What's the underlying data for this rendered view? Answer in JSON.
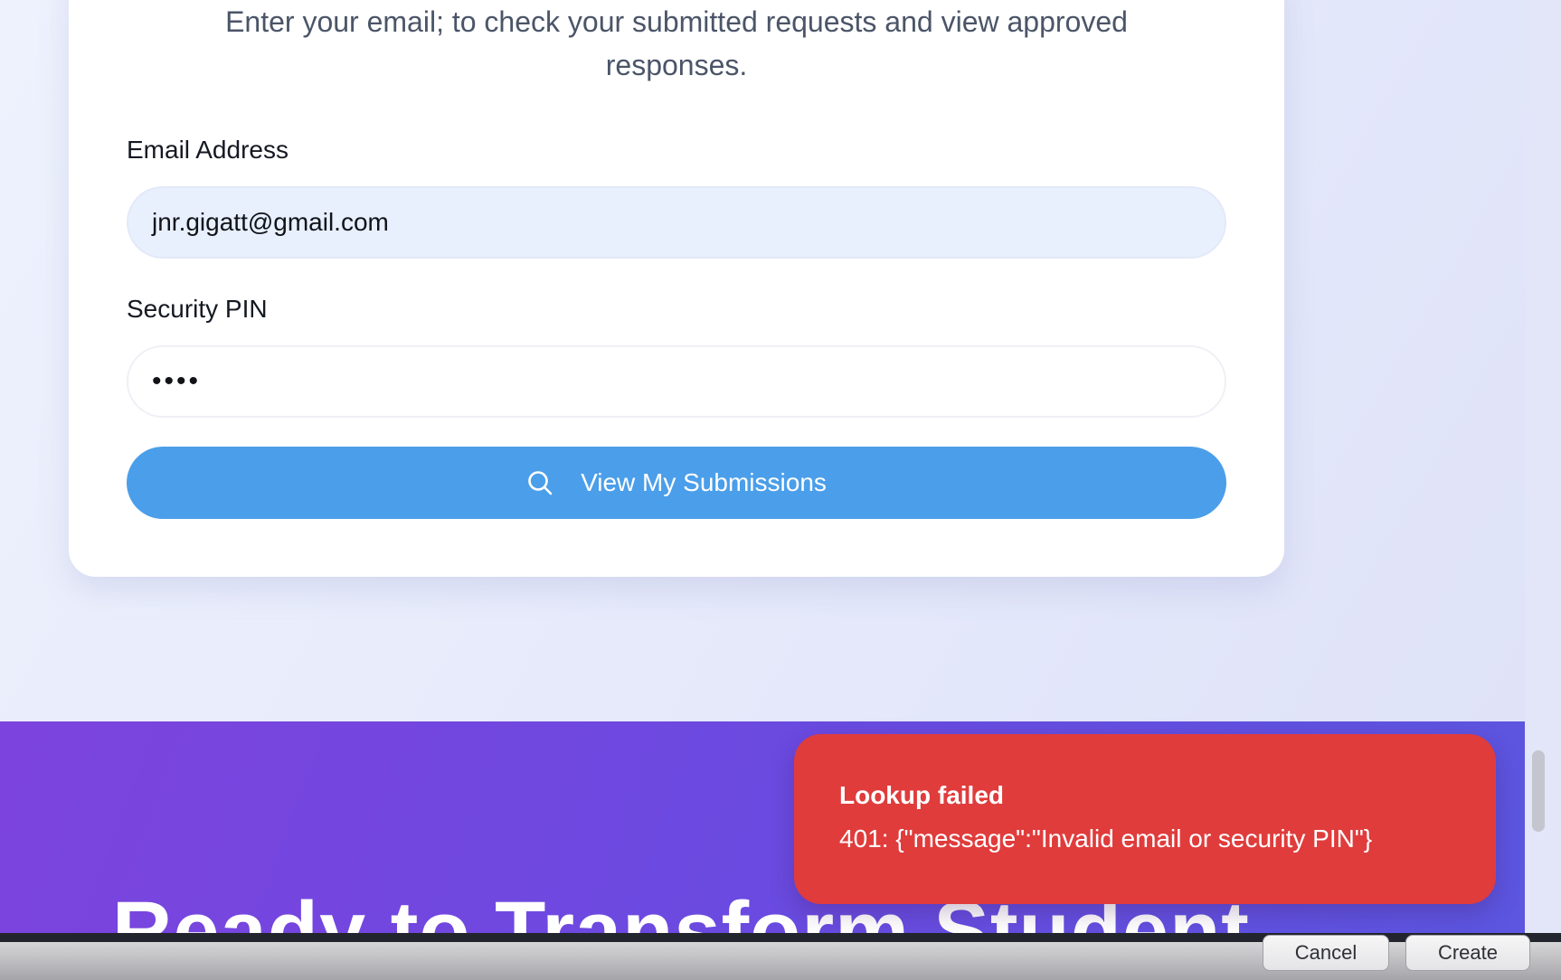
{
  "card": {
    "subtitle": "Enter your email; to check your submitted requests and view approved responses.",
    "email_label": "Email Address",
    "email_value": "jnr.gigatt@gmail.com",
    "pin_label": "Security PIN",
    "pin_value": "••••",
    "submit_label": "View My Submissions",
    "submit_icon": "search-icon"
  },
  "banner": {
    "title": "Ready to Transform Student"
  },
  "toast": {
    "title": "Lookup failed",
    "message": "401: {\"message\":\"Invalid email or security PIN\"}",
    "color": "#e03c3c"
  },
  "dialog": {
    "cancel_label": "Cancel",
    "create_label": "Create"
  },
  "colors": {
    "primary_button": "#4b9ee9",
    "banner_start": "#7d43de",
    "banner_end": "#5b56e0"
  }
}
